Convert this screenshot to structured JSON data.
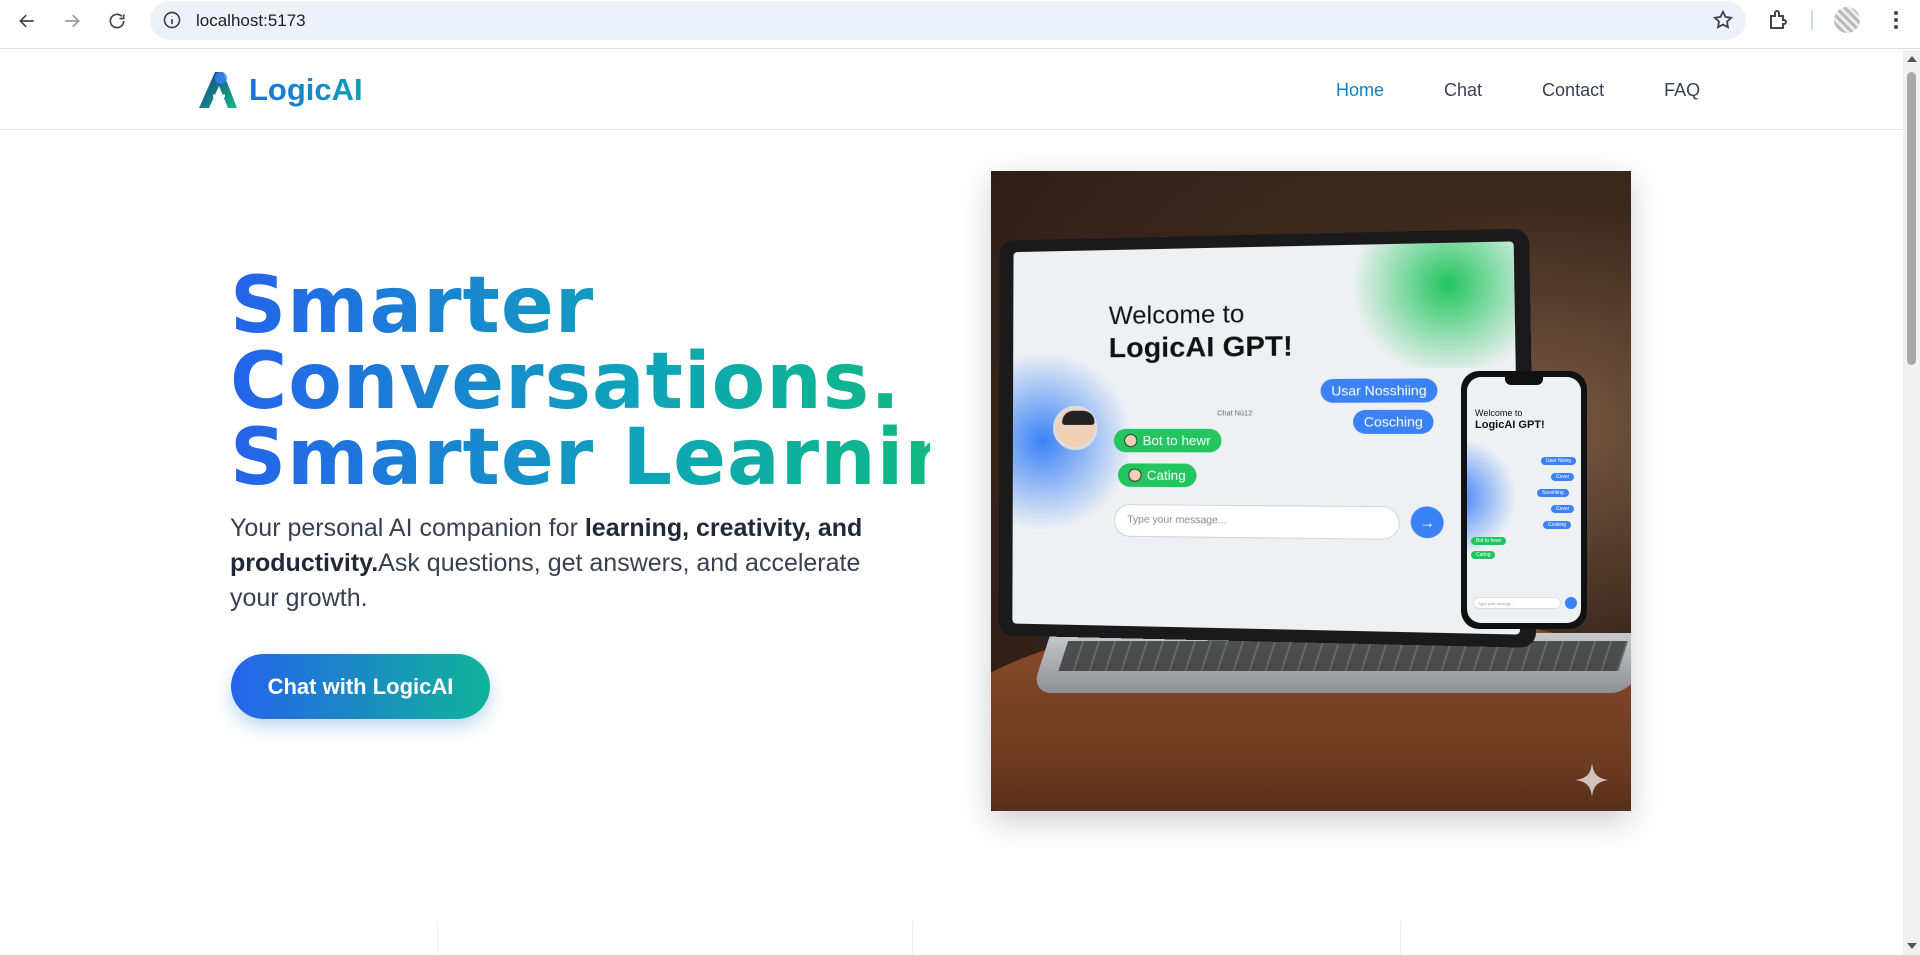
{
  "browser": {
    "url": "localhost:5173"
  },
  "site": {
    "brand": "LogicAI",
    "nav": [
      {
        "label": "Home",
        "active": true
      },
      {
        "label": "Chat",
        "active": false
      },
      {
        "label": "Contact",
        "active": false
      },
      {
        "label": "FAQ",
        "active": false
      }
    ]
  },
  "hero": {
    "title_lines": [
      "Smarter",
      "Conversations.",
      "Smarter Learning."
    ],
    "desc_prefix": "Your personal AI companion for ",
    "desc_bold": "learning, creativity, and productivity.",
    "desc_suffix": "Ask questions, get answers, and accelerate your growth.",
    "cta_label": "Chat with LogicAI"
  },
  "illustration": {
    "laptop": {
      "title_line1": "Welcome to",
      "title_line2": "LogicAI GPT!",
      "mini_label": "Chat Nú12",
      "bubbles_right": [
        "Usar Nosshiing",
        "Cosching"
      ],
      "bubbles_left": [
        "Bot to hewr",
        "Cating"
      ],
      "input_placeholder": "Type your message..."
    },
    "phone": {
      "title_line1": "Welcome to",
      "title_line2": "LogicAI GPT!",
      "bubbles_right": [
        "Usar Noing",
        "Cover",
        "Sosshiing",
        "Cover",
        "Cosking"
      ],
      "bubbles_left": [
        "Bot to hewr",
        "Cating"
      ],
      "input_placeholder": "Type your mesage..."
    }
  }
}
